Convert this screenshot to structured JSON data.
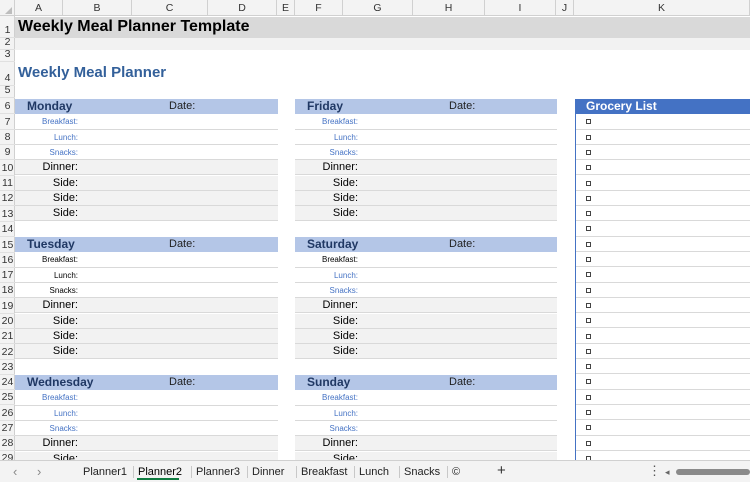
{
  "columns": [
    "A",
    "B",
    "C",
    "D",
    "E",
    "F",
    "G",
    "H",
    "I",
    "J",
    "K"
  ],
  "rows": [
    "1",
    "2",
    "3",
    "4",
    "5",
    "6",
    "7",
    "8",
    "9",
    "10",
    "11",
    "12",
    "13",
    "14",
    "15",
    "16",
    "17",
    "18",
    "19",
    "20",
    "21",
    "22",
    "23",
    "24",
    "25",
    "26",
    "27",
    "28",
    "29"
  ],
  "title": "Weekly Meal Planner Template",
  "subtitle": "Weekly Meal Planner",
  "date_label": "Date:",
  "meal_labels": {
    "breakfast": "Breakfast:",
    "lunch": "Lunch:",
    "snacks": "Snacks:",
    "dinner": "Dinner:",
    "side": "Side:"
  },
  "days": [
    {
      "name": "Monday"
    },
    {
      "name": "Friday"
    },
    {
      "name": "Tuesday"
    },
    {
      "name": "Saturday"
    },
    {
      "name": "Wednesday"
    },
    {
      "name": "Sunday"
    }
  ],
  "grocery": {
    "title": "Grocery List",
    "item_count": 23
  },
  "sheet_tabs": [
    "Planner1",
    "Planner2",
    "Planner3",
    "Dinner",
    "Breakfast",
    "Lunch",
    "Snacks",
    "©"
  ],
  "active_tab": "Planner2",
  "colors": {
    "day_header_bg": "#b4c6e7",
    "day_header_text": "#203864",
    "grocery_header_bg": "#4472c4",
    "subtitle": "#33609a",
    "small_label_blue": "#4472c4",
    "active_tab_underline": "#107c41"
  },
  "icons": {
    "tab_prev": "chevron-left-icon",
    "tab_next": "chevron-right-icon",
    "add_sheet": "plus-icon",
    "more": "vertical-ellipsis-icon"
  }
}
